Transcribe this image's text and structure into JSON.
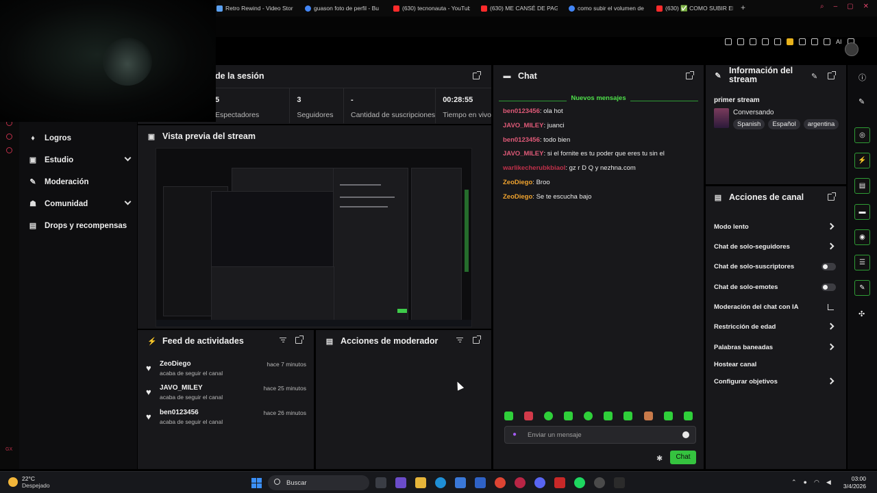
{
  "browser": {
    "tabs": [
      {
        "label": "Retro Rewind - Video Stor",
        "color": "#5aa0f0"
      },
      {
        "label": "guason foto de perfil - Bu",
        "color": "#4285f4"
      },
      {
        "label": "(630) tecnonauta - YouTub",
        "color": "#ff2b2b"
      },
      {
        "label": "(630) ME CANSÉ DE PAGA",
        "color": "#ff2b2b"
      },
      {
        "label": "como subir el volumen de",
        "color": "#4285f4"
      },
      {
        "label": "(630) ✅ COMO SUBIR EL",
        "color": "#ff2b2b"
      }
    ],
    "new_tab": "+",
    "ai_label": "AI"
  },
  "sidebar": {
    "items": [
      {
        "label": "Logros",
        "icon": "trophy-icon",
        "glyph": "♦",
        "expandable": false
      },
      {
        "label": "Estudio",
        "icon": "video-icon",
        "glyph": "▣",
        "expandable": true
      },
      {
        "label": "Moderación",
        "icon": "wrench-icon",
        "glyph": "✎",
        "expandable": false
      },
      {
        "label": "Comunidad",
        "icon": "people-icon",
        "glyph": "☗",
        "expandable": true
      },
      {
        "label": "Drops y recompensas",
        "icon": "gift-icon",
        "glyph": "▤",
        "expandable": false
      }
    ]
  },
  "session": {
    "title": "de la sesión",
    "stats": [
      {
        "value": "5",
        "label": "Espectadores"
      },
      {
        "value": "3",
        "label": "Seguidores"
      },
      {
        "value": "-",
        "label": "Cantidad de suscripciones"
      },
      {
        "value": "00:28:55",
        "label": "Tiempo en vivo"
      }
    ]
  },
  "preview": {
    "title": "Vista previa del stream"
  },
  "feed": {
    "title": "Feed de actividades",
    "items": [
      {
        "user": "ZeoDiego",
        "action": "acaba de seguir el canal",
        "time": "hace 7 minutos"
      },
      {
        "user": "JAVO_MILEY",
        "action": "acaba de seguir el canal",
        "time": "hace 25 minutos"
      },
      {
        "user": "ben0123456",
        "action": "acaba de seguir el canal",
        "time": "hace 26 minutos"
      }
    ]
  },
  "mod_actions": {
    "title": "Acciones de moderador"
  },
  "chat": {
    "title": "Chat",
    "new_messages_label": "Nuevos mensajes",
    "messages": [
      {
        "user": "ben0123456",
        "color": "#e05a78",
        "text": "ola hot"
      },
      {
        "user": "JAVO_MILEY",
        "color": "#e05a78",
        "text": "juanci"
      },
      {
        "user": "ben0123456",
        "color": "#e05a78",
        "text": "todo bien"
      },
      {
        "user": "JAVO_MILEY",
        "color": "#e05a78",
        "text": "si el fornite es tu poder que eres tu sin el"
      },
      {
        "user": "warlikecherubkbiaol",
        "color": "#c0304a",
        "text": "gz r D Q y nezhna.com"
      },
      {
        "user": "ZeoDiego",
        "color": "#f0a32e",
        "text": "Broo"
      },
      {
        "user": "ZeoDiego",
        "color": "#f0a32e",
        "text": "Se te escucha bajo"
      }
    ],
    "input_placeholder": "Enviar un mensaje",
    "send_label": "Chat"
  },
  "stream_info": {
    "title": "Información del stream",
    "stream_title": "primer stream",
    "category": "Conversando",
    "tags": [
      "Spanish",
      "Español",
      "argentina"
    ]
  },
  "channel_actions": {
    "title": "Acciones de canal",
    "items": [
      {
        "label": "Modo lento",
        "control": "chevron"
      },
      {
        "label": "Chat de solo-seguidores",
        "control": "chevron"
      },
      {
        "label": "Chat de solo-suscriptores",
        "control": "toggle"
      },
      {
        "label": "Chat de solo-emotes",
        "control": "toggle"
      },
      {
        "label": "Moderación del chat con IA",
        "control": "external"
      },
      {
        "label": "Restricción de edad",
        "control": "chevron"
      },
      {
        "label": "Palabras baneadas",
        "control": "chevron"
      },
      {
        "label": "Hostear canal",
        "control": "none"
      },
      {
        "label": "Configurar objetivos",
        "control": "chevron"
      }
    ]
  },
  "taskbar": {
    "temperature": "22°C",
    "weather": "Despejado",
    "search_label": "Buscar",
    "time": "03:00",
    "date": "3/4/2026"
  },
  "left_strip": {
    "label": "GX"
  },
  "colors": {
    "accent": "#35c33f",
    "panel": "#18181b",
    "background": "#000000"
  }
}
